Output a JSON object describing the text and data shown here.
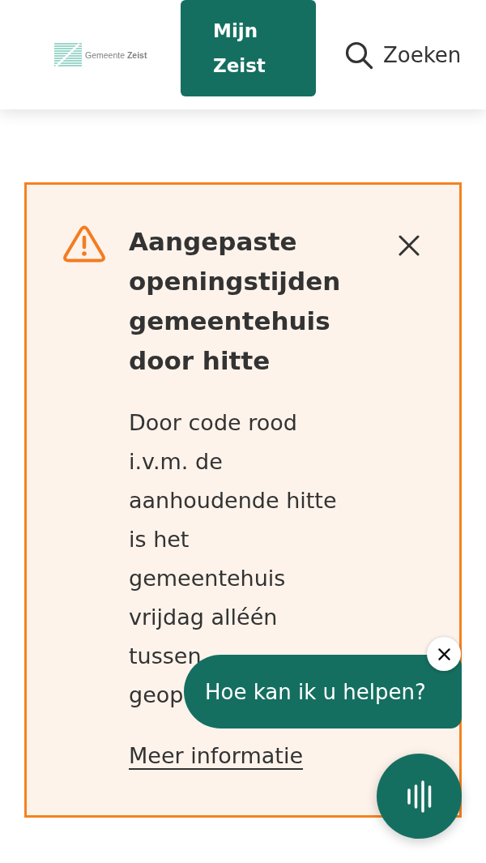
{
  "header": {
    "logo": {
      "text": "Gemeente **Zeist**"
    },
    "account_button": {
      "label": "Mijn Zeist"
    },
    "search": {
      "label": "Zoeken"
    }
  },
  "alert": {
    "kind": "warning",
    "title": "Aangepaste openingstijden gemeentehuis door hitte",
    "body": [
      "Door code rood i.v.m. de aanhoudende hitte is het gemeentehuis vrijdag alléén tussen",
      "geop"
    ],
    "link": "Meer informatie"
  },
  "chat": {
    "prompt": "Hoe kan ik u helpen?"
  }
}
